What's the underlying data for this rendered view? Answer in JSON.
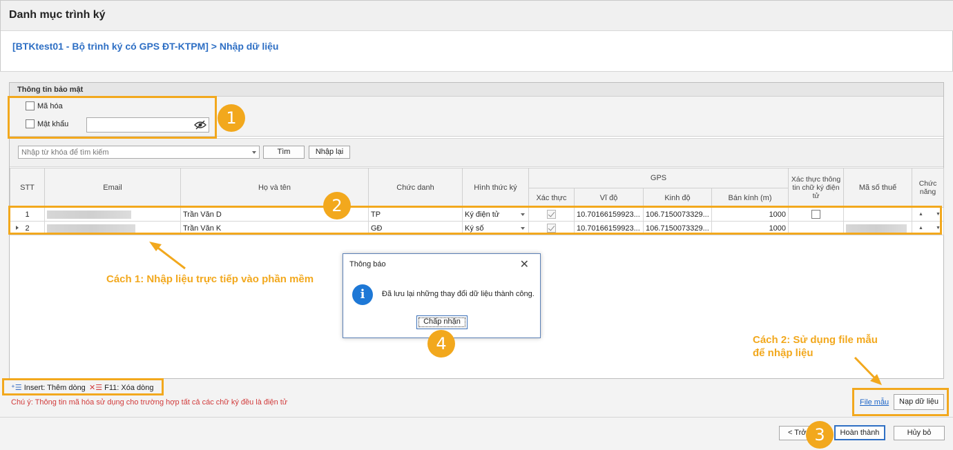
{
  "window": {
    "title": "Danh mục trình ký"
  },
  "breadcrumb": "[BTKtest01 - Bộ trình ký có GPS ĐT-KTPM] > Nhập dữ liệu",
  "security": {
    "header": "Thông tin bảo mật",
    "encrypt_label": "Mã hóa",
    "password_label": "Mật khẩu",
    "password_value": ""
  },
  "search": {
    "placeholder": "Nhập từ khóa để tìm kiếm",
    "find_label": "Tìm",
    "reset_label": "Nhập lại"
  },
  "table": {
    "columns": {
      "stt": "STT",
      "email": "Email",
      "name": "Họ và tên",
      "title": "Chức danh",
      "sign_type": "Hình thức ký",
      "gps": "GPS",
      "gps_verify": "Xác thực",
      "lat": "Vĩ độ",
      "lng": "Kinh độ",
      "radius": "Bán kính (m)",
      "verify_digital": "Xác thực thông tin chữ ký điện tử",
      "tax": "Mã số thuế",
      "func": "Chức năng"
    },
    "rows": [
      {
        "stt": "1",
        "name": "Trần Văn D",
        "title": "TP",
        "sign_type": "Ký điện tử",
        "lat": "10.70166159923...",
        "lng": "106.7150073329...",
        "radius": "1000"
      },
      {
        "stt": "2",
        "name": "Trần Văn K",
        "title": "GĐ",
        "sign_type": "Ký số",
        "lat": "10.70166159923...",
        "lng": "106.7150073329...",
        "radius": "1000"
      }
    ]
  },
  "shortcuts": {
    "insert": "Insert: Thêm dòng",
    "delete": "F11: Xóa dòng"
  },
  "note": "Chú ý: Thông tin mã hóa sử dụng cho trường hợp tất cả các chữ ký đều là điện tử",
  "file_sample": "File mẫu",
  "load_data": "Nạp dữ liệu",
  "footer": {
    "back": "< Trở",
    "finish": "Hoàn thành",
    "cancel": "Hủy bỏ"
  },
  "dialog": {
    "title": "Thông báo",
    "message": "Đã lưu lại những thay đổi dữ liệu thành công.",
    "ok": "Chấp nhận"
  },
  "annotations": {
    "badge1": "1",
    "badge2": "2",
    "badge3": "3",
    "badge4": "4",
    "way1": "Cách 1: Nhập liệu trực tiếp vào phần mềm",
    "way2_line1": "Cách 2: Sử dụng file mẫu",
    "way2_line2": "để nhập liệu",
    "accent_color": "#f2a81d"
  }
}
